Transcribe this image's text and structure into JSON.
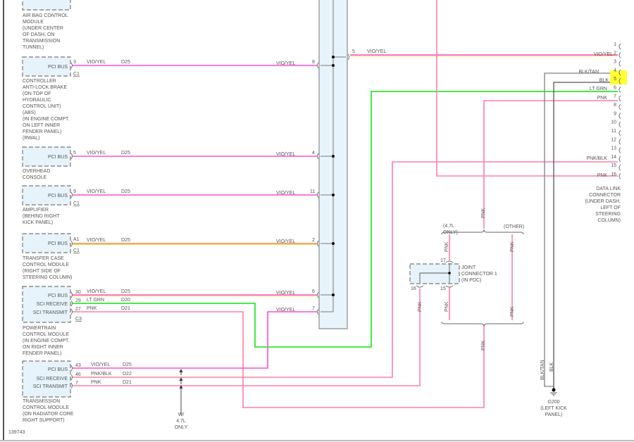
{
  "diagram_id": "139743",
  "colors": {
    "vio_yel": "#ff4fcf",
    "pnk": "#ff7fa6",
    "lt_grn": "#2ee82e",
    "blk_tan": "#808080",
    "blk": "#555555",
    "highlight": "#ffff33",
    "module_fill": "#e6f3fb"
  },
  "modules": {
    "airbag": {
      "lines": [
        "AIR BAG CONTROL",
        "MODULE",
        "(UNDER CENTER",
        "OF DASH, ON",
        "TRANSMISSION",
        "TUNNEL)"
      ]
    },
    "abs": {
      "pin_label": "PCI BUS",
      "pin": "3",
      "connector": "C1",
      "wire_color": "VIO/YEL",
      "circuit": "D25",
      "lines": [
        "CONTROLLER",
        "ANTI-LOCK BRAKE",
        "(ON TOP OF",
        "HYDRAULIC",
        "CONTROL UNIT)",
        "(ABS)",
        "(IN ENGINE COMPT.",
        "ON LEFT INNER",
        "FENDER PANEL)",
        "(RWAL)"
      ]
    },
    "overhead": {
      "pin_label": "PCI BUS",
      "pin": "5",
      "wire_color": "VIO/YEL",
      "circuit": "D25",
      "lines": [
        "OVERHEAD",
        "CONSOLE"
      ]
    },
    "amplifier": {
      "pin_label": "PCI BUS",
      "pin": "9",
      "connector": "C1",
      "wire_color": "VIO/YEL",
      "circuit": "D25",
      "lines": [
        "AMPLIFIER",
        "(BEHIND RIGHT",
        "KICK PANEL)"
      ]
    },
    "transfer": {
      "pin_label": "PCI BUS",
      "pin": "A1",
      "connector": "C1",
      "wire_color": "VIO/YEL",
      "circuit": "D25",
      "lines": [
        "TRANSFER CASE",
        "CONTROL MODULE",
        "(RIGHT SIDE OF",
        "STEERING COLUMN)"
      ]
    },
    "pcm": {
      "connector": "C3",
      "pins": [
        {
          "label": "PCI BUS",
          "pin": "30",
          "wire_color": "VIO/YEL",
          "circuit": "D25"
        },
        {
          "label": "SCI RECEIVE",
          "pin": "29",
          "wire_color": "LT GRN",
          "circuit": "D20"
        },
        {
          "label": "SCI TRANSMIT",
          "pin": "27",
          "wire_color": "PNK",
          "circuit": "D21"
        }
      ],
      "lines": [
        "POWERTRAIN",
        "CONTROL MODULE",
        "(IN ENGINE COMPT.",
        "ON RIGHT INNER",
        "FENDER PANEL)"
      ]
    },
    "tcm": {
      "pins": [
        {
          "label": "PCI BUS",
          "pin": "43",
          "wire_color": "VIO/YEL",
          "circuit": "D25"
        },
        {
          "label": "SCI RECEIVE",
          "pin": "46",
          "wire_color": "PNK/BLK",
          "circuit": "D22"
        },
        {
          "label": "SCI TRANSMIT",
          "pin": "7",
          "wire_color": "PNK",
          "circuit": "D21"
        }
      ],
      "lines": [
        "TRANSMISSION",
        "CONTROL MODULE",
        "(ON RADIATOR CORE",
        "RIGHT SUPPORT)"
      ]
    }
  },
  "splice": {
    "pins": [
      {
        "pin": "8",
        "wire_color": "VIO/YEL"
      },
      {
        "pin": "4",
        "wire_color": "VIO/YEL"
      },
      {
        "pin": "11",
        "wire_color": "VIO/YEL"
      },
      {
        "pin": "2",
        "wire_color": "VIO/YEL"
      },
      {
        "pin": "6",
        "wire_color": "VIO/YEL"
      },
      {
        "pin": "7",
        "wire_color": "VIO/YEL"
      }
    ],
    "out_pin": "5",
    "out_wire_color": "VIO/YEL"
  },
  "tcm_note": [
    "W/",
    "4.7L",
    "ONLY"
  ],
  "data_link": {
    "pins": [
      "1",
      "2",
      "3",
      "4",
      "5",
      "6",
      "7",
      "8",
      "9",
      "10",
      "11",
      "12",
      "13",
      "14",
      "15",
      "16"
    ],
    "wires": {
      "2": "VIO/YEL",
      "4": "BLK/TAN",
      "5": "BLK",
      "6": "LT GRN",
      "7": "PNK",
      "14": "PNK/BLK",
      "16": "PNK"
    },
    "highlighted_pins": [
      "4",
      "5"
    ],
    "lines": [
      "DATA LINK",
      "CONNECTOR",
      "(UNDER DASH,",
      "LEFT OF",
      "STEERING",
      "COLUMN)"
    ]
  },
  "joint_connector": {
    "lines": [
      "JOINT",
      "CONNECTOR 1",
      "(IN PDC)"
    ],
    "pins": {
      "top": "17",
      "left": "16",
      "right": "15"
    },
    "option_a": [
      "(4.7L",
      "ONLY)"
    ],
    "option_b": "(OTHER)",
    "wire_color": "PNK"
  },
  "ground": {
    "name": "G200",
    "lines": [
      "(LEFT KICK",
      "PANEL)"
    ],
    "wire_a": "BLK/TAN",
    "wire_b": "BLK"
  }
}
